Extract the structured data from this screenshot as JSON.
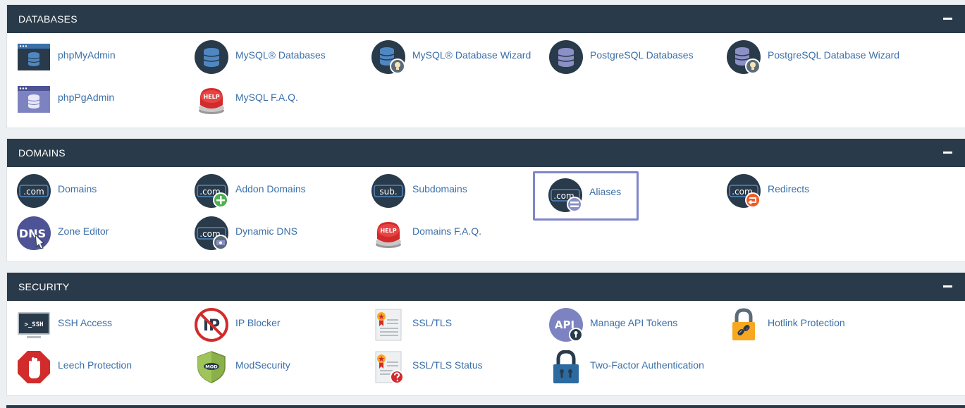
{
  "sections": [
    {
      "title": "DATABASES",
      "items": [
        {
          "label": "phpMyAdmin",
          "icon": "phpmyadmin-icon"
        },
        {
          "label": "MySQL® Databases",
          "icon": "mysql-databases-icon"
        },
        {
          "label": "MySQL® Database Wizard",
          "icon": "mysql-wizard-icon"
        },
        {
          "label": "PostgreSQL Databases",
          "icon": "postgresql-databases-icon"
        },
        {
          "label": "PostgreSQL Database Wizard",
          "icon": "postgresql-wizard-icon"
        },
        {
          "label": "phpPgAdmin",
          "icon": "phppgadmin-icon"
        },
        {
          "label": "MySQL F.A.Q.",
          "icon": "help-button-icon"
        }
      ]
    },
    {
      "title": "DOMAINS",
      "items": [
        {
          "label": "Domains",
          "icon": "domains-icon",
          "badge": ".com"
        },
        {
          "label": "Addon Domains",
          "icon": "addon-domains-icon",
          "badge": ".com"
        },
        {
          "label": "Subdomains",
          "icon": "subdomains-icon",
          "badge": "sub."
        },
        {
          "label": "Aliases",
          "icon": "aliases-icon",
          "badge": ".com"
        },
        {
          "label": "Redirects",
          "icon": "redirects-icon",
          "badge": ".com"
        },
        {
          "label": "Zone Editor",
          "icon": "dns-icon",
          "badge": "DNS"
        },
        {
          "label": "Dynamic DNS",
          "icon": "dynamic-dns-icon",
          "badge": ".com"
        },
        {
          "label": "Domains F.A.Q.",
          "icon": "help-button-icon"
        }
      ]
    },
    {
      "title": "SECURITY",
      "items": [
        {
          "label": "SSH Access",
          "icon": "terminal-icon",
          "badge": ">_SSH"
        },
        {
          "label": "IP Blocker",
          "icon": "ip-blocker-icon",
          "badge": "IP"
        },
        {
          "label": "SSL/TLS",
          "icon": "certificate-icon"
        },
        {
          "label": "Manage API Tokens",
          "icon": "api-token-icon",
          "badge": "API"
        },
        {
          "label": "Hotlink Protection",
          "icon": "lock-link-icon"
        },
        {
          "label": "Leech Protection",
          "icon": "stop-hand-icon"
        },
        {
          "label": "ModSecurity",
          "icon": "shield-icon",
          "badge": "MOD"
        },
        {
          "label": "SSL/TLS Status",
          "icon": "certificate-status-icon"
        },
        {
          "label": "Two-Factor Authentication",
          "icon": "padlock-icon"
        }
      ]
    }
  ],
  "help_text": "HELP",
  "colors": {
    "header": "#293a4a",
    "link": "#3b6fa8",
    "focus_outline": "#7f86c9"
  }
}
